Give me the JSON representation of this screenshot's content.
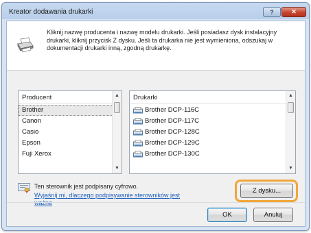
{
  "window": {
    "title": "Kreator dodawania drukarki",
    "help_label": "?",
    "close_label": "✕"
  },
  "header": {
    "instructions": "Kliknij nazwę producenta i nazwę modelu drukarki. Jeśli posiadasz dysk instalacyjny drukarki, kliknij przycisk Z dysku. Jeśli ta drukarka nie jest wymieniona, odszukaj w dokumentacji drukarki inną, zgodną drukarkę."
  },
  "manufacturers": {
    "header": "Producent",
    "items": [
      "Brother",
      "Canon",
      "Casio",
      "Epson",
      "Fuji Xerox"
    ],
    "selected_index": 0
  },
  "printers": {
    "header": "Drukarki",
    "items": [
      "Brother DCP-116C",
      "Brother DCP-117C",
      "Brother DCP-128C",
      "Brother DCP-129C",
      "Brother DCP-130C"
    ]
  },
  "signature": {
    "text": "Ten sterownik jest podpisany cyfrowo.",
    "link": "Wyjaśnij mi, dlaczego podpisywanie sterowników jest ważne"
  },
  "buttons": {
    "have_disk": "Z dysku...",
    "ok": "OK",
    "cancel": "Anuluj"
  },
  "colors": {
    "highlight": "#f0a63a",
    "link": "#1c5fbf"
  },
  "icons": {
    "printer": "printer-icon",
    "signature": "certificate-icon"
  }
}
